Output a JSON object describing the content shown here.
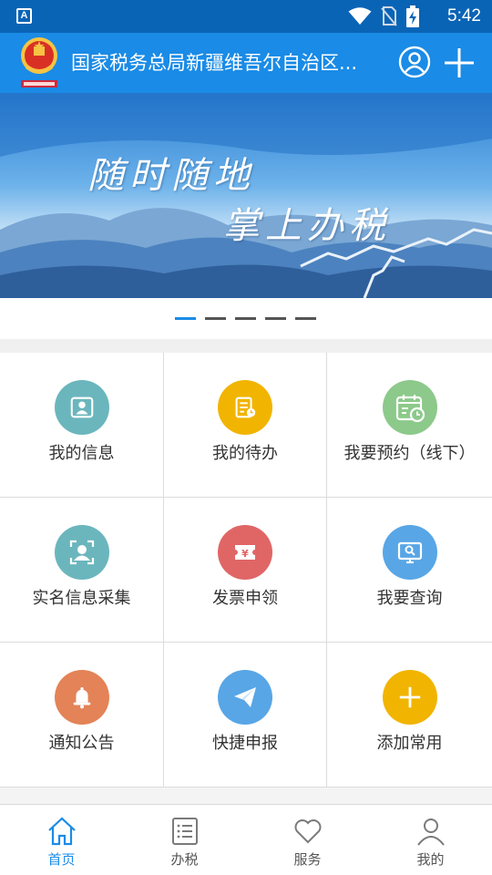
{
  "status_bar": {
    "app_indicator": "A",
    "time": "5:42",
    "icons": [
      "wifi-icon",
      "no-sim-icon",
      "battery-charging-icon"
    ]
  },
  "header": {
    "title": "国家税务总局新疆维吾尔自治区...",
    "icons": [
      "tax-emblem-logo",
      "user-icon",
      "plus-icon"
    ]
  },
  "banner": {
    "line1": "随时随地",
    "line2": "掌上办税",
    "slide_count": 5,
    "active_slide": 1
  },
  "grid": [
    {
      "label": "我的信息",
      "icon": "user-info-icon",
      "color": "#6bb6bd"
    },
    {
      "label": "我的待办",
      "icon": "todo-icon",
      "color": "#f1b400"
    },
    {
      "label": "我要预约（线下）",
      "icon": "calendar-clock-icon",
      "color": "#8cc98a"
    },
    {
      "label": "实名信息采集",
      "icon": "face-scan-icon",
      "color": "#6bb6bd"
    },
    {
      "label": "发票申领",
      "icon": "invoice-icon",
      "color": "#e06666"
    },
    {
      "label": "我要查询",
      "icon": "search-screen-icon",
      "color": "#58a6e6"
    },
    {
      "label": "通知公告",
      "icon": "bell-icon",
      "color": "#e38357"
    },
    {
      "label": "快捷申报",
      "icon": "paper-plane-icon",
      "color": "#58a6e6"
    },
    {
      "label": "添加常用",
      "icon": "plus-icon",
      "color": "#f1b400"
    }
  ],
  "bottom_nav": [
    {
      "label": "首页",
      "icon": "home-icon",
      "active": true
    },
    {
      "label": "办税",
      "icon": "list-icon",
      "active": false
    },
    {
      "label": "服务",
      "icon": "heart-icon",
      "active": false
    },
    {
      "label": "我的",
      "icon": "person-icon",
      "active": false
    }
  ],
  "colors": {
    "status_bar": "#0a64b6",
    "header": "#1a8be6",
    "accent": "#1a8be6"
  }
}
